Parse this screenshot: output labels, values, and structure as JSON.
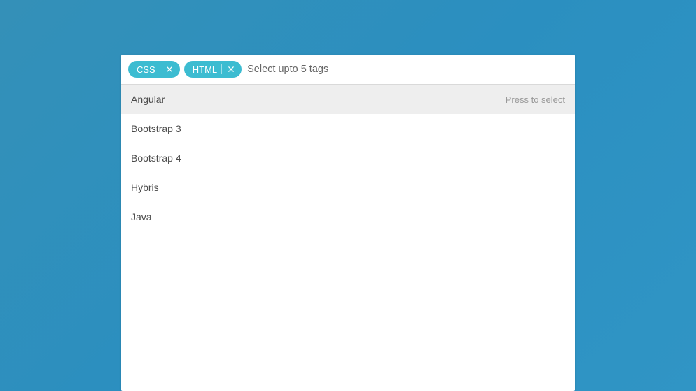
{
  "multiselect": {
    "placeholder": "Select upto 5 tags",
    "select_hint": "Press to select",
    "selected": [
      {
        "label": "CSS"
      },
      {
        "label": "HTML"
      }
    ],
    "options": [
      {
        "label": "Angular",
        "highlighted": true
      },
      {
        "label": "Bootstrap 3",
        "highlighted": false
      },
      {
        "label": "Bootstrap 4",
        "highlighted": false
      },
      {
        "label": "Hybris",
        "highlighted": false
      },
      {
        "label": "Java",
        "highlighted": false
      }
    ],
    "colors": {
      "chip_bg": "#3cbcd1",
      "highlight_bg": "#eeeeee"
    }
  }
}
